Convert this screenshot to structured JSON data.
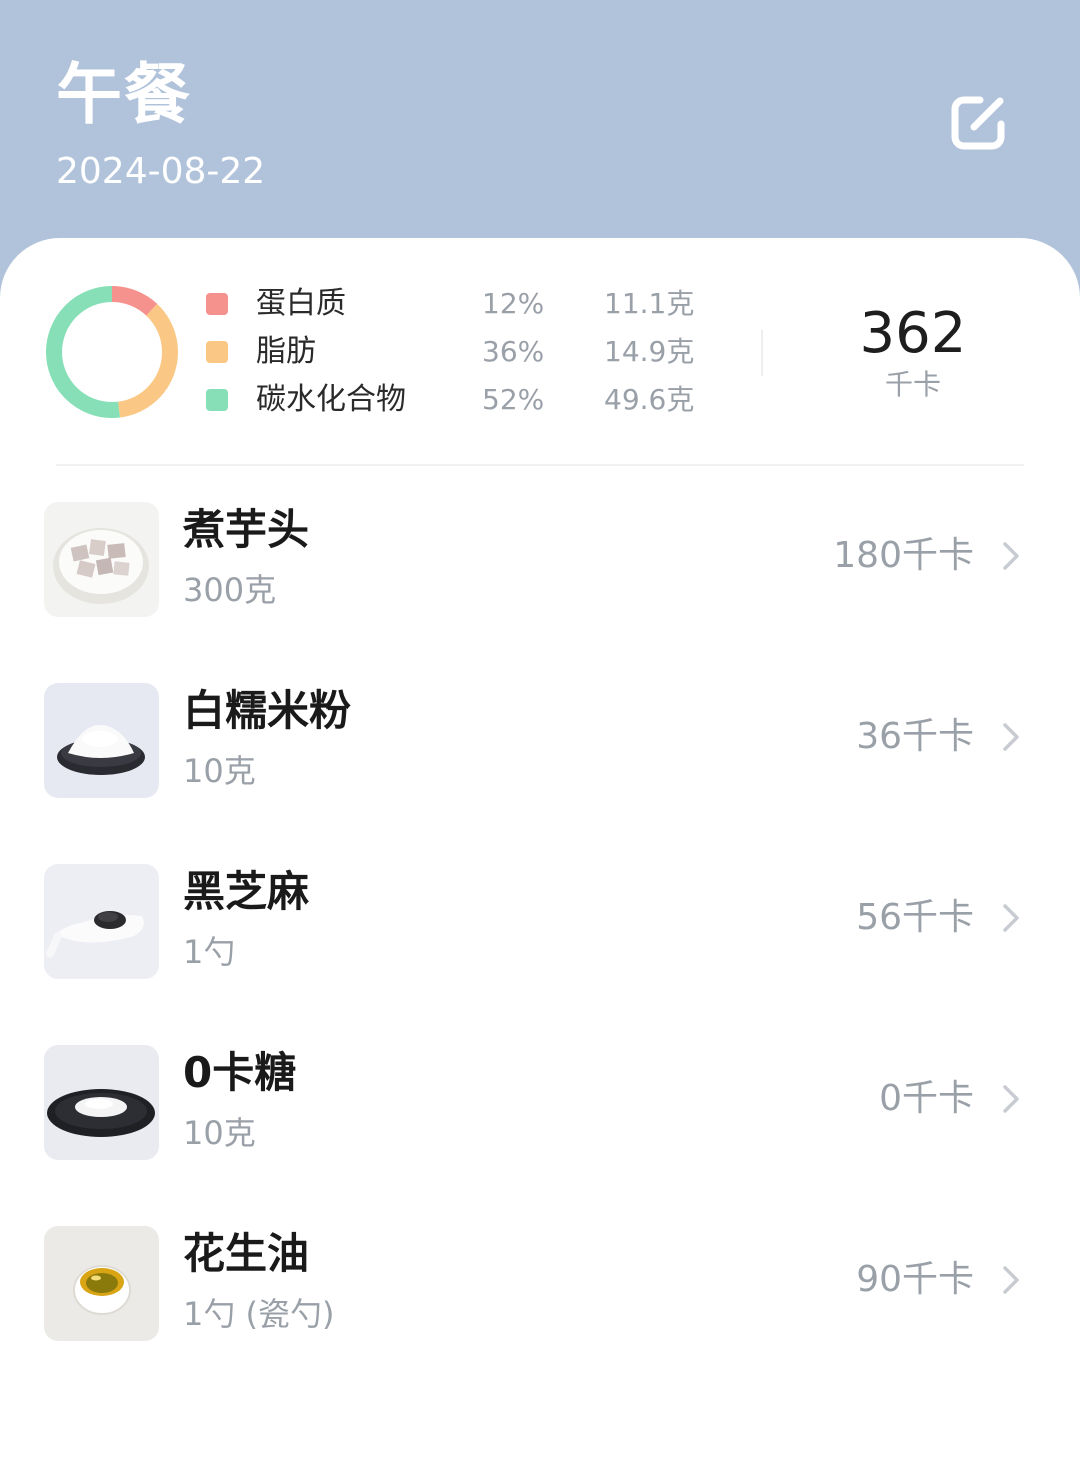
{
  "header": {
    "title": "午餐",
    "date": "2024-08-22"
  },
  "summary": {
    "macros": [
      {
        "name": "蛋白质",
        "percent": "12%",
        "grams": "11.1克",
        "color": "#f6928e",
        "fraction": 0.12
      },
      {
        "name": "脂肪",
        "percent": "36%",
        "grams": "14.9克",
        "color": "#fbc784",
        "fraction": 0.36
      },
      {
        "name": "碳水化合物",
        "percent": "52%",
        "grams": "49.6克",
        "color": "#86dfb6",
        "fraction": 0.52
      }
    ],
    "total_kcal": "362",
    "total_unit": "千卡"
  },
  "foods": [
    {
      "name": "煮芋头",
      "amount": "300克",
      "kcal": "180千卡",
      "icon": "taro-image"
    },
    {
      "name": "白糯米粉",
      "amount": "10克",
      "kcal": "36千卡",
      "icon": "rice-flour-image"
    },
    {
      "name": "黑芝麻",
      "amount": "1勺",
      "kcal": "56千卡",
      "icon": "black-sesame-image"
    },
    {
      "name": "0卡糖",
      "amount": "10克",
      "kcal": "0千卡",
      "icon": "zero-cal-sugar-image"
    },
    {
      "name": "花生油",
      "amount": "1勺 (瓷勺)",
      "kcal": "90千卡",
      "icon": "peanut-oil-image"
    }
  ],
  "colors": {
    "header_bg": "#b1c3db",
    "card_bg": "#ffffff",
    "muted_text": "#9aa0a8"
  }
}
